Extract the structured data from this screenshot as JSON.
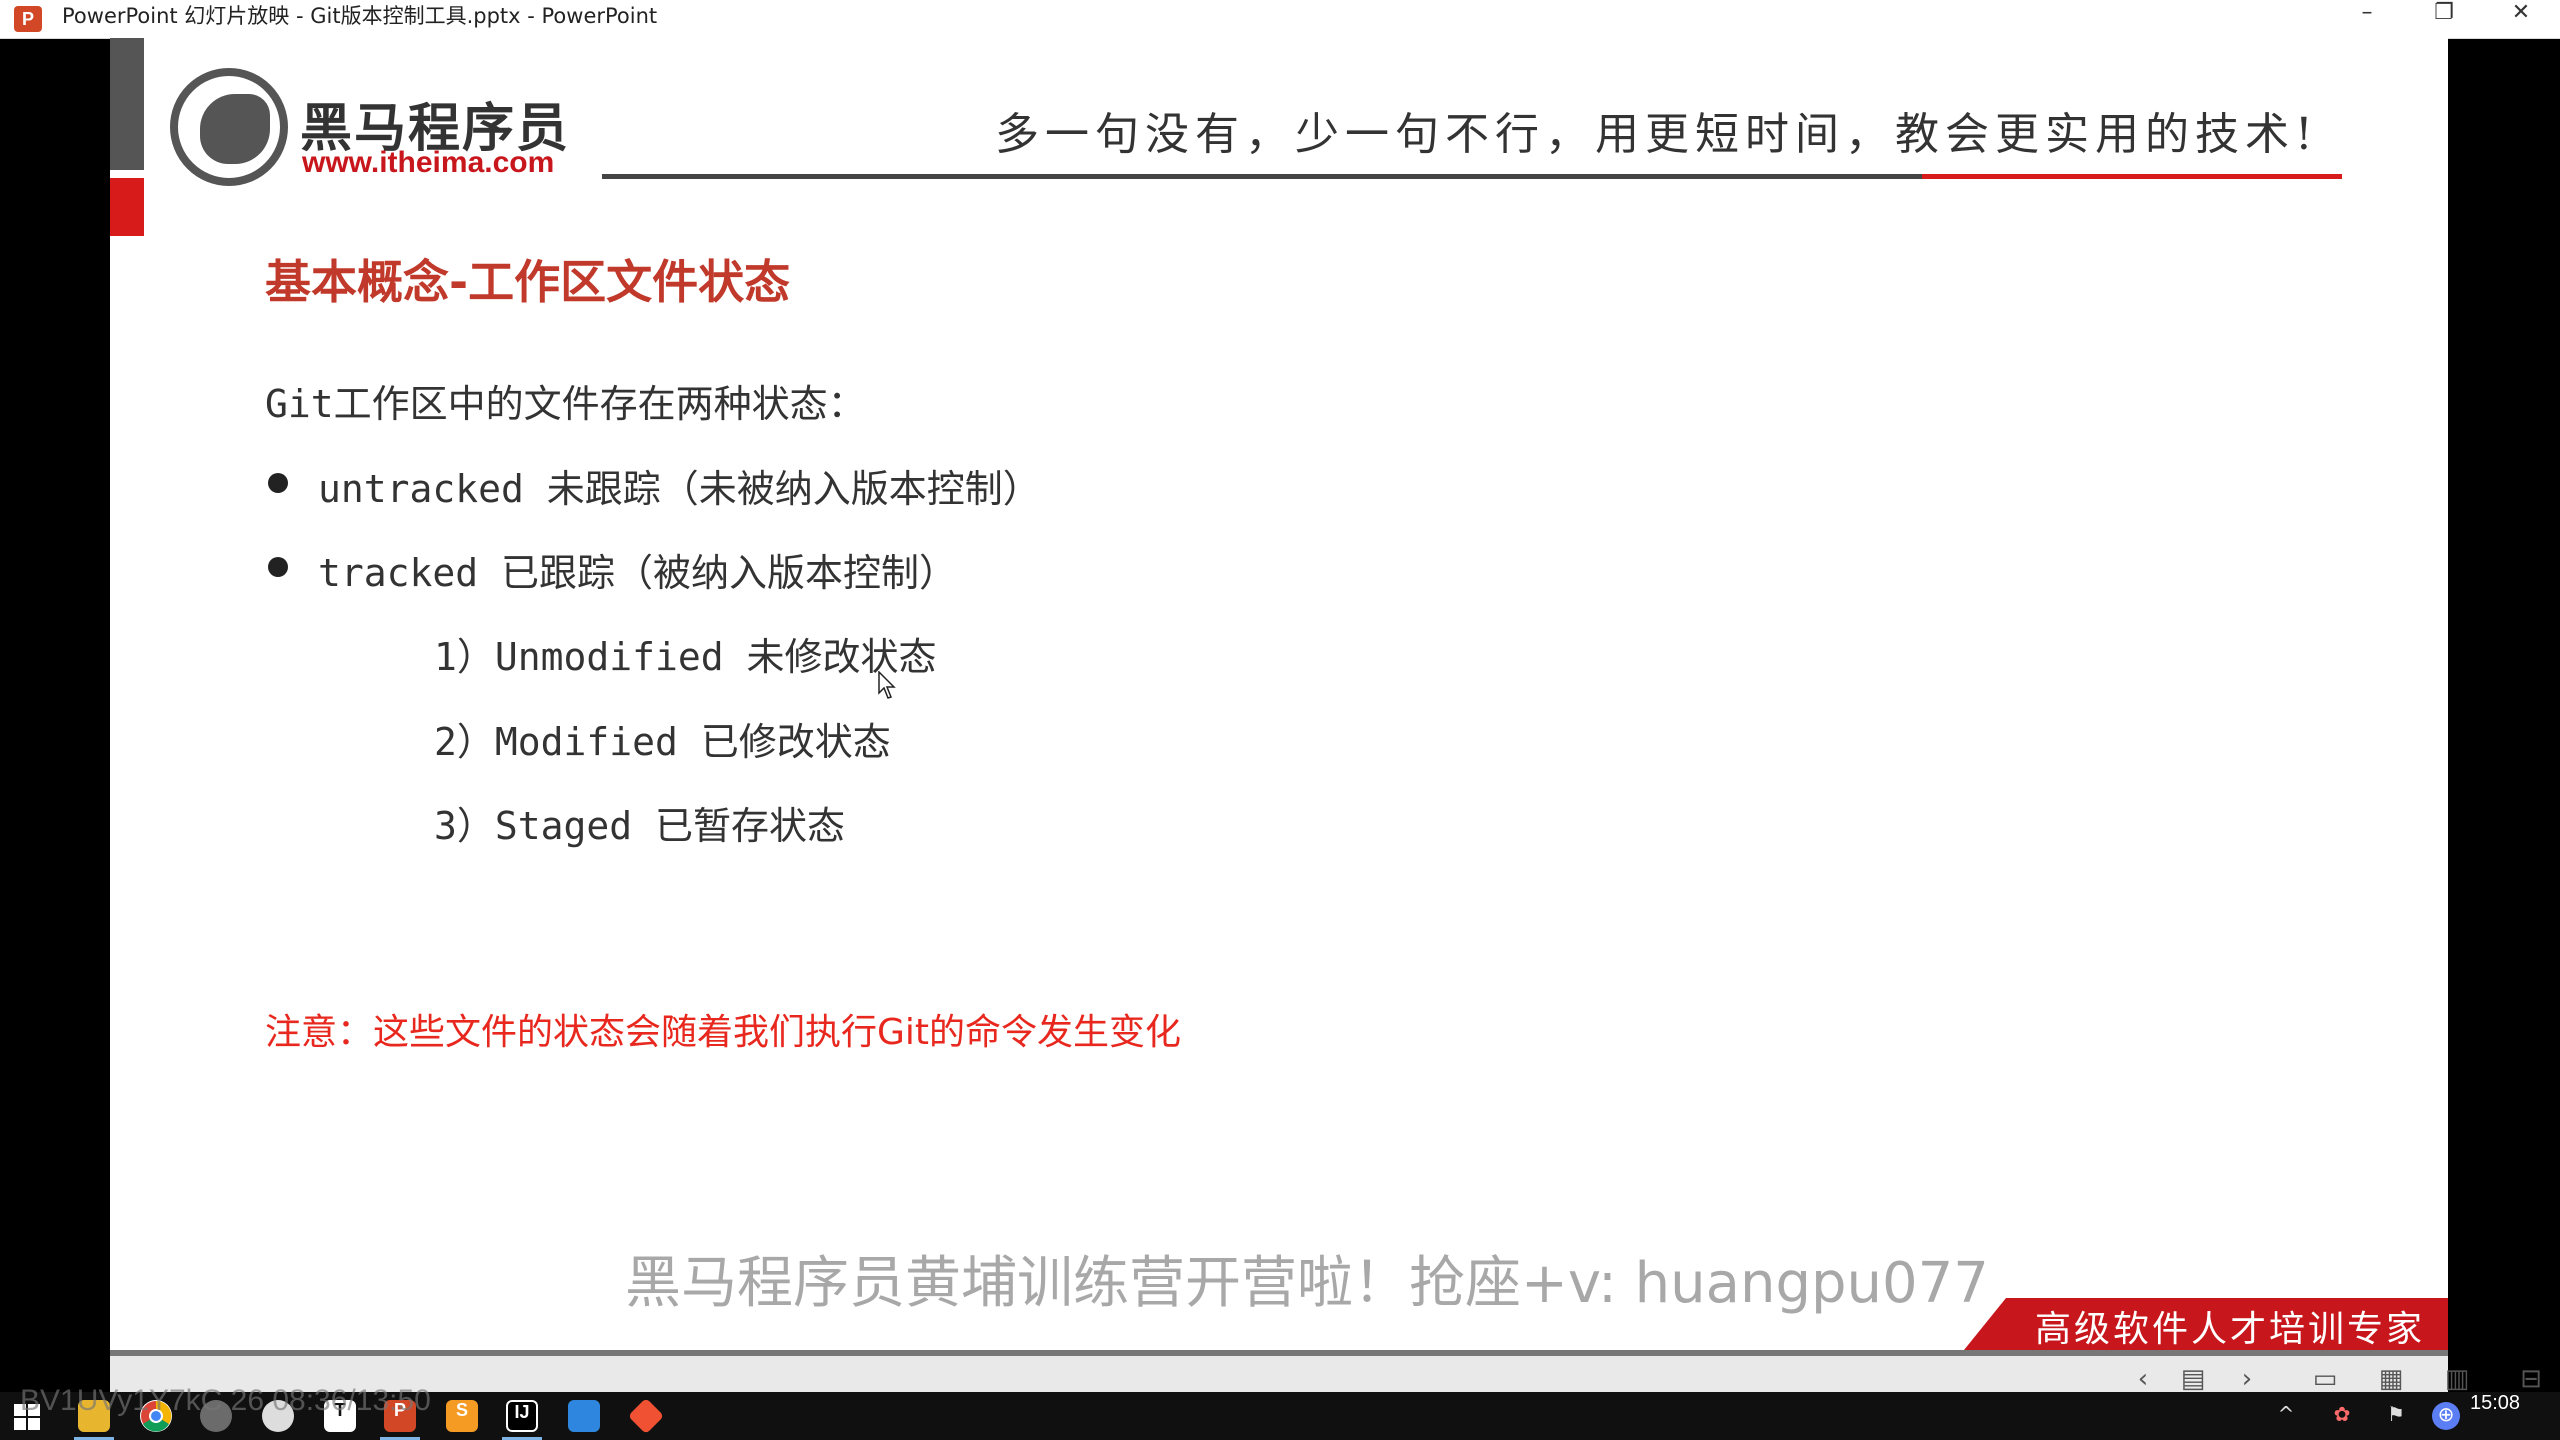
{
  "window": {
    "title": "PowerPoint 幻灯片放映  -  Git版本控制工具.pptx - PowerPoint",
    "app_icon": "P",
    "minimize": "–",
    "restore": "❐",
    "close": "✕"
  },
  "slide": {
    "logo_name": "黑马程序员",
    "logo_url": "www.itheima.com",
    "slogan": "多一句没有，少一句不行，用更短时间，教会更实用的技术!",
    "title": "基本概念-工作区文件状态",
    "intro": "Git工作区中的文件存在两种状态：",
    "bullets": [
      "untracked 未跟踪（未被纳入版本控制）",
      " tracked 已跟踪（被纳入版本控制）"
    ],
    "sub_items": [
      "1）Unmodified 未修改状态",
      "2）Modified 已修改状态",
      "3）Staged 已暂存状态"
    ],
    "note": "注意：这些文件的状态会随着我们执行Git的命令发生变化",
    "watermark": "黑马程序员黄埔训练营开营啦！抢座+v: huangpu077",
    "badge": "高级软件人才培训专家",
    "colors": {
      "accent_red": "#c8161d",
      "title_red": "#c0392b",
      "note_red": "#e8281e"
    }
  },
  "navbar": {
    "prev": "‹",
    "menu": "▤",
    "next": "›",
    "normal_view": "▭",
    "sorter_view": "▦",
    "reading_view": "▥",
    "slideshow_view": "⊟"
  },
  "taskbar": {
    "video_id": "BV1UVy1Y7kC 26 08:36/13:50",
    "clock": "15:08",
    "icons": [
      "windows-start-icon",
      "file-explorer-icon",
      "chrome-icon",
      "app-icon",
      "steam-icon",
      "typora-icon",
      "powerpoint-icon",
      "sublime-icon",
      "intellij-icon",
      "app-window-icon",
      "git-icon"
    ]
  }
}
